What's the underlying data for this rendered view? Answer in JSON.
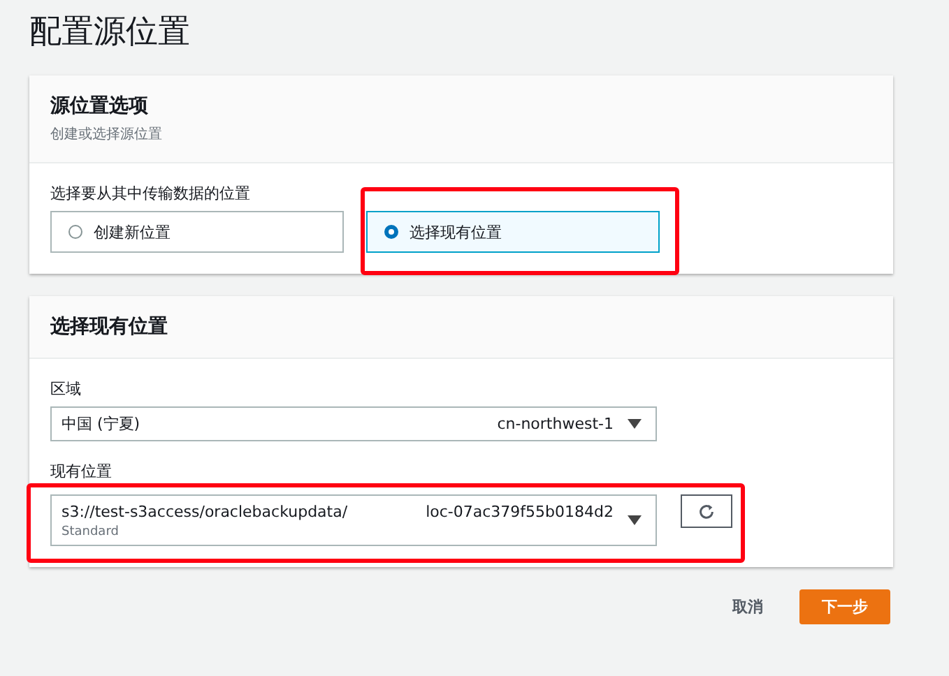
{
  "page_title": "配置源位置",
  "options_panel": {
    "title": "源位置选项",
    "subtitle": "创建或选择源位置",
    "question": "选择要从其中传输数据的位置",
    "choices": [
      {
        "label": "创建新位置",
        "selected": false,
        "highlighted": false
      },
      {
        "label": "选择现有位置",
        "selected": true,
        "highlighted": true
      }
    ]
  },
  "existing_panel": {
    "title": "选择现有位置",
    "region": {
      "label": "区域",
      "value": "中国 (宁夏)",
      "code": "cn-northwest-1"
    },
    "location": {
      "label": "现有位置",
      "value": "s3://test-s3access/oraclebackupdata/",
      "id": "loc-07ac379f55b0184d2",
      "detail": "Standard",
      "highlighted": true
    }
  },
  "buttons": {
    "cancel": "取消",
    "next": "下一步"
  }
}
